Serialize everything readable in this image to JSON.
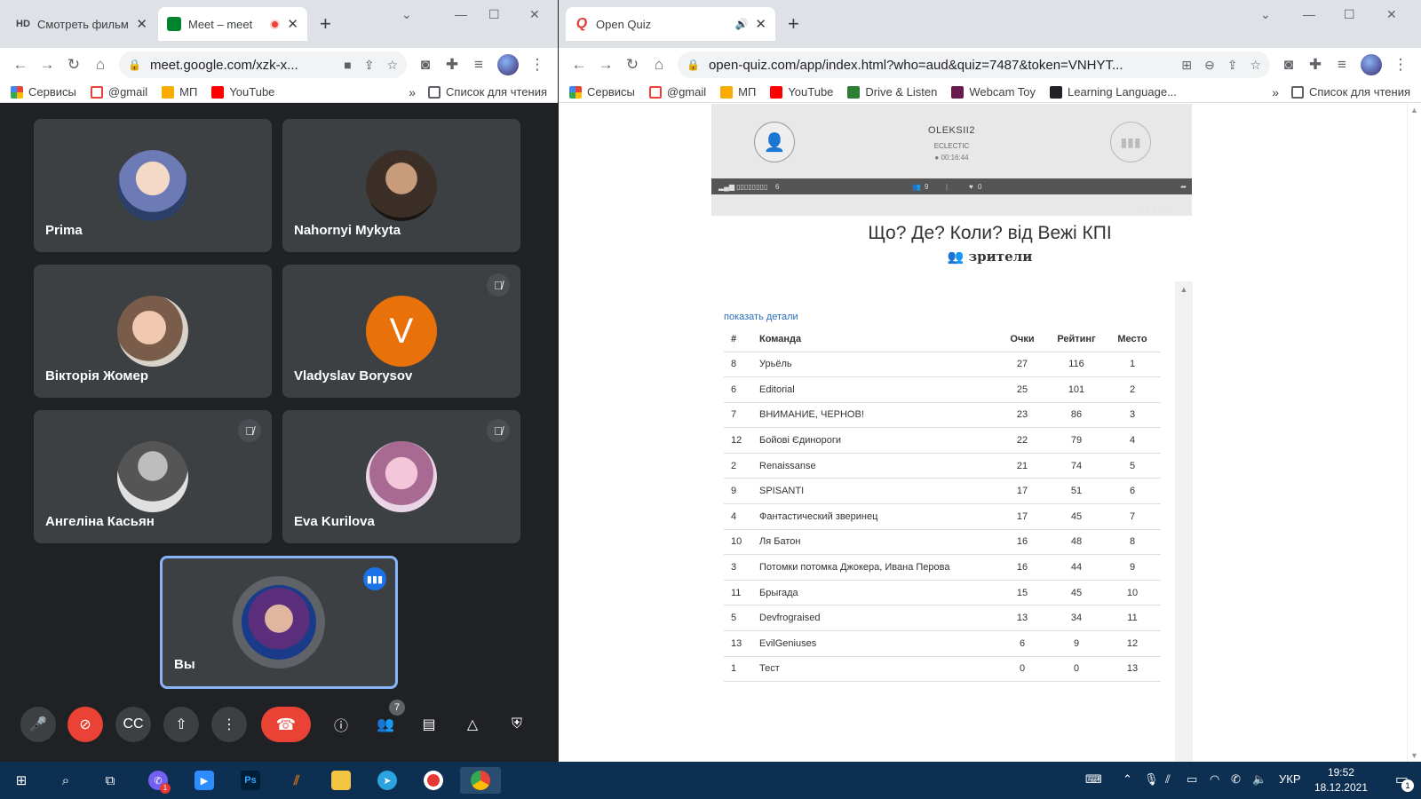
{
  "left_browser": {
    "tabs": [
      {
        "badge": "HD",
        "title": "Смотреть фильм",
        "active": false
      },
      {
        "title": "Meet – meet",
        "active": true
      }
    ],
    "url": "meet.google.com/xzk-x...",
    "bookmarks": [
      "Сервисы",
      "@gmail",
      "МП",
      "YouTube"
    ],
    "reading_list": "Список для чтения"
  },
  "meet": {
    "participants": [
      {
        "name": "Prima",
        "muted": false
      },
      {
        "name": "Nahornyi Mykyta",
        "muted": false
      },
      {
        "name": "Вікторія Жомер",
        "muted": false
      },
      {
        "name": "Vladyslav Borysov",
        "muted": true,
        "initial": "V"
      },
      {
        "name": "Ангеліна Касьян",
        "muted": true
      },
      {
        "name": "Eva Kurilova",
        "muted": true
      }
    ],
    "self": {
      "name": "Вы",
      "speaking": true
    },
    "people_count": "7"
  },
  "right_browser": {
    "tab_title": "Open Quiz",
    "url": "open-quiz.com/app/index.html?who=aud&quiz=7487&token=VNHYT...",
    "bookmarks": [
      "Сервисы",
      "@gmail",
      "МП",
      "YouTube",
      "Drive & Listen",
      "Webcam Toy",
      "Learning Language..."
    ],
    "reading_list": "Список для чтения"
  },
  "player": {
    "name": "OLEKSII2",
    "genre": "ECLECTIC",
    "time": "00:16:44",
    "listeners": "6",
    "people": "9",
    "likes": "0"
  },
  "quiz": {
    "title": "Що? Де? Коли? від Вежі КПІ",
    "subtitle": "зрители",
    "details_link": "показать детали",
    "columns": [
      "#",
      "Команда",
      "Очки",
      "Рейтинг",
      "Место"
    ],
    "rows": [
      {
        "num": "8",
        "team": "Урьёль",
        "points": "27",
        "rating": "116",
        "place": "1"
      },
      {
        "num": "6",
        "team": "Editorial",
        "points": "25",
        "rating": "101",
        "place": "2"
      },
      {
        "num": "7",
        "team": "ВНИМАНИЕ, ЧЕРНОВ!",
        "points": "23",
        "rating": "86",
        "place": "3"
      },
      {
        "num": "12",
        "team": "Бойові Єдинороги",
        "points": "22",
        "rating": "79",
        "place": "4"
      },
      {
        "num": "2",
        "team": "Renaissanse",
        "points": "21",
        "rating": "74",
        "place": "5"
      },
      {
        "num": "9",
        "team": "SPISANTI",
        "points": "17",
        "rating": "51",
        "place": "6"
      },
      {
        "num": "4",
        "team": "Фантастический зверинец",
        "points": "17",
        "rating": "45",
        "place": "7"
      },
      {
        "num": "10",
        "team": "Ля Батон",
        "points": "16",
        "rating": "48",
        "place": "8"
      },
      {
        "num": "3",
        "team": "Потомки потомка Джокера, Ивана Перова",
        "points": "16",
        "rating": "44",
        "place": "9"
      },
      {
        "num": "11",
        "team": "Брыгада",
        "points": "15",
        "rating": "45",
        "place": "10"
      },
      {
        "num": "5",
        "team": "Devfrograised",
        "points": "13",
        "rating": "34",
        "place": "11"
      },
      {
        "num": "13",
        "team": "EvilGeniuses",
        "points": "6",
        "rating": "9",
        "place": "12"
      },
      {
        "num": "1",
        "team": "Тест",
        "points": "0",
        "rating": "0",
        "place": "13"
      }
    ]
  },
  "taskbar": {
    "lang": "УКР",
    "time": "19:52",
    "date": "18.12.2021",
    "notifications": "1",
    "viber_badge": "1"
  },
  "colors": {
    "meet_bg": "#202124",
    "tile_bg": "#3c4043",
    "end_call": "#ea4335",
    "taskbar": "#0d2f52",
    "link": "#2a6ebb"
  }
}
